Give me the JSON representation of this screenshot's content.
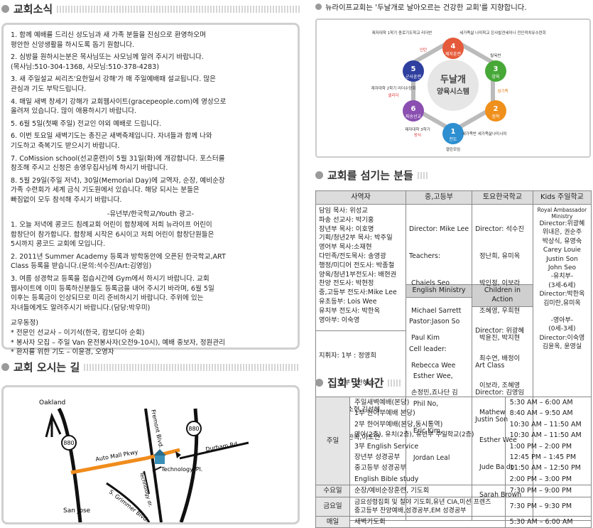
{
  "left": {
    "news_title": "교회소식",
    "news_items": [
      "1. 함께 예배를 드리신 성도님과 새 가족 분들을 진심으로 환영하오며\n    평안한 신앙생활을 하시도록 돕기 원합니다.",
      "2. 심방을 원하시는분은 목사님또는 사모님께 알려 주시기 바랍니다.\n    (목사님:510-304-1368, 사모님:510-378-4283)",
      "3. 새 주일설교 씨리즈'요한일서 강해'가 매 주일예배때 설교됩니다. 많은\n    관심과 기도 부탁드립니다.",
      "4. 매일 새벽 창세기 강해가 교회웹사이트(gracepeople.com)에 영상으로\n    올려져 있습니다. 많이 애용하시기 바랍니다.",
      "5. 6월 5일(첫째 주일) 전교인 야외 예배로 드립니다.",
      "6. 이번 토요일 새벽기도는 총진군 새벽축제입니다. 자녀들과 함께 나와\n    기도하고 축복기도 받으시기 바랍니다.",
      "7. CoMission school(선교훈련)이 5월 31일(화)에 개강합니다. 포스터를\n    참조해 주시고 신청은 송영우집사님께 하시기 바랍니다.",
      "8. 5월 29일(주일 저녁), 30일(Memorial Day)에 교역자, 순장, 예비순장\n    가족 수련회가 세계 금식 기도원에서 있습니다. 해당 되시는 분들은\n    빠짐없이 모두 참석해 주시기 바랍니다."
    ],
    "youth_heading": "-유년부/한국학교/Youth 광고-",
    "youth_items": [
      "1. 오늘 저녁에 콩코드 침례교회 어린이 합창제에 저희 뉴라이프 어린이\n    합창단이 참가합니다. 합창제 시작은 6시이고 저희 어린이 합창단원들은\n    5시까지 콩코드 교회에 모입니다.",
      "2. 2011년 Summer Academy 등록과 방학동안에 오픈된 한국학교,ART\n    Class 등록을 받습니다.(문의:석수진/Art:김영임)",
      "3. 여름 성경학교 등록을 접습시간에 Gym에서 하시기 바랍니다. 교회\n    웹사이트에 이미 등록하신분들도 등록금을 내어 주시기 바라며, 6월 5일\n    이후는 등록금이 인상되므로 미리 준비하시기 바랍니다. 주위에 있는\n    자녀들에게도 알려주시기 바랍니다.(담당:박우미)"
    ],
    "prayer_heading": "교우동정)",
    "prayer_items": [
      "* 전문인 선교사 – 이기석(한국, 캄보디아 순회)",
      "* 봉사자 모집 – 주일 Van 운전봉사자(오전9-10시), 예배 중보자, 정원관리",
      "* 환자를 위한 기도 – 이윤경, 오영자"
    ],
    "map_title": "교회 오시는 길",
    "map_labels": {
      "oakland": "Oakland",
      "fremont": "Fremont Blvd.",
      "i880_a": "880",
      "i880_b": "880",
      "durham": "Durham Rd",
      "automall": "Auto Mall Pkwy",
      "technology_dr": "Technology dr.",
      "technology_pl": "Technology. Pl.",
      "grimmer": "S. Grimmer Blvd.",
      "sanjose": "San Jose"
    }
  },
  "right": {
    "vision_text": "뉴라이프교회는 '두날개로 날아오르는 건강한 교회'를 지향합니다.",
    "diagram": {
      "center_line1": "두날개",
      "center_line2": "양육시스템",
      "nodes": [
        {
          "num": "4",
          "name": "제자훈련"
        },
        {
          "num": "3",
          "name": "양육"
        },
        {
          "num": "2",
          "name": "정착"
        },
        {
          "num": "1",
          "name": "전도"
        },
        {
          "num": "6",
          "name": "파송선교"
        },
        {
          "num": "5",
          "name": "군사훈련"
        }
      ],
      "notes": {
        "top_left": "제자대학 1학기\n종로기도학교\n리더반",
        "top_left_tag": "인턴",
        "top_right": "세가족삶 나미학교\n은사발견세미나\n전인적치유수련회",
        "top_right_tag": "탈옥반",
        "mid_left": "제자대학 2학기\n리더수양회",
        "mid_left_tag": "셀리더",
        "mid_right_tag": "섬기족",
        "bot_left": "제자대학 3학기",
        "bot_left_tag": "방식",
        "bot_right": "세가족반\n세가족삶나미시여",
        "bottom": "열린모임"
      }
    },
    "servers_title": "교회를 섬기는 분들",
    "servers": {
      "col1_header": "사역자",
      "col2_header": "중,고등부",
      "col3_header": "토요한국학교",
      "col4_header": "Kids 주일학교",
      "col1": [
        "담임 목사: 위성교",
        "파송 선교사: 박기홍",
        "장년부 목사: 이호명",
        "기획/청년2부 목사: 박주일",
        "영어부 목사:소재현",
        "다민족/전도목사: 송영광",
        "행정/미디어 전도사: 박종철",
        "양육/청년1부전도사: 배현권",
        "찬양 전도사: 박현정",
        "중,고등부 전도사:Mike Lee",
        "유초등부: Lois Wee",
        "유치부 전도사: 박한옥",
        "영아부: 이숙영"
      ],
      "col1_extra": [
        "지휘자: 1부 : 정영희",
        "          2부 : 안혜승",
        "피아노: 박소현,김선혜",
        "오르간: 박한옥,이도연"
      ],
      "col2": [
        "Director: Mike Lee",
        "Teachers:",
        " Chaiels Seo",
        " Michael Sarrett",
        " Paul Kim",
        " Rebecca Wee",
        " 손정민,죠나단 김"
      ],
      "col2_sub_header": "English Ministry",
      "col2_sub": [
        "Pastor:Jason So",
        "Cell leader:",
        "  Esther Wee,",
        "  Phil No,",
        "  Eric Kim,",
        "  Jordan Leal"
      ],
      "col3": [
        "Director: 석수진",
        "  정난희, 유미옥",
        "  박인정, 이보라",
        "  조혜영, 우희현",
        "  박윤진, 박지현",
        "Art Class",
        "Director: 김영임",
        "Justin Son"
      ],
      "col3_sub_header": "Children in Action",
      "col3_sub": [
        "Director: 위광혜",
        "  최수연, 배정이",
        "  이보라, 조혜영",
        "  Mathew",
        "  Esther Wee",
        "  Jude Baldo",
        "  Sarah Brown"
      ],
      "col4": [
        "Royal Ambassador Ministry",
        "Director:위광혜",
        "위내은, 권순주",
        "박상식, 유영숙",
        "Carey Louie",
        "Justin Son",
        "John Seo",
        "-유치부-",
        "(3세-6세)",
        "Director:박한옥",
        "김미란,유미옥",
        "",
        "-영아부-",
        "(0세-3세)",
        "Director:이숙영",
        "김윤옥, 윤영실"
      ]
    },
    "schedule_title": "집회 및 시간",
    "schedule": [
      {
        "day": "주일",
        "items": [
          {
            "name": "주일새벽예배(본당)",
            "time": "5:30 AM – 6:00 AM"
          },
          {
            "name": "1부 한어부예배 본당)",
            "time": "8:40 AM – 9:50 AM"
          },
          {
            "name": "2부 한어부예배(본당,동시통역)",
            "time": "10:30 AM – 11:50 AM"
          },
          {
            "name": "영아(2층), 유치(2층), 유년부 주일학교(2층)",
            "time": "10:30 AM – 11:50 AM"
          },
          {
            "name": "3부 English Service",
            "time": "1:00 PM – 2:00 PM"
          },
          {
            "name": "장년부 성경공부",
            "time": "12:45 PM – 1:45 PM"
          },
          {
            "name": "중고등부 성경공부",
            "time": "11:50 AM – 12:50 PM"
          },
          {
            "name": "English Bible study",
            "time": "2:00 PM – 3:00 PM"
          }
        ]
      },
      {
        "day": "수요일",
        "items": [
          {
            "name": "순장/예비순장훈련, 기도회",
            "time": "7:30 PM – 9:00 PM"
          }
        ]
      },
      {
        "day": "금요일",
        "items": [
          {
            "name": "금요성령집회 및 철야 기도회,유년 CIA,미션 프렌즈\n중고등부 찬양예배,성경공부,EM 성경공부",
            "time": "7:30 PM – 9:30 PM"
          }
        ]
      },
      {
        "day": "매일",
        "items": [
          {
            "name": "새벽기도회",
            "time": "5:30 AM – 6:00 AM"
          }
        ]
      }
    ]
  }
}
